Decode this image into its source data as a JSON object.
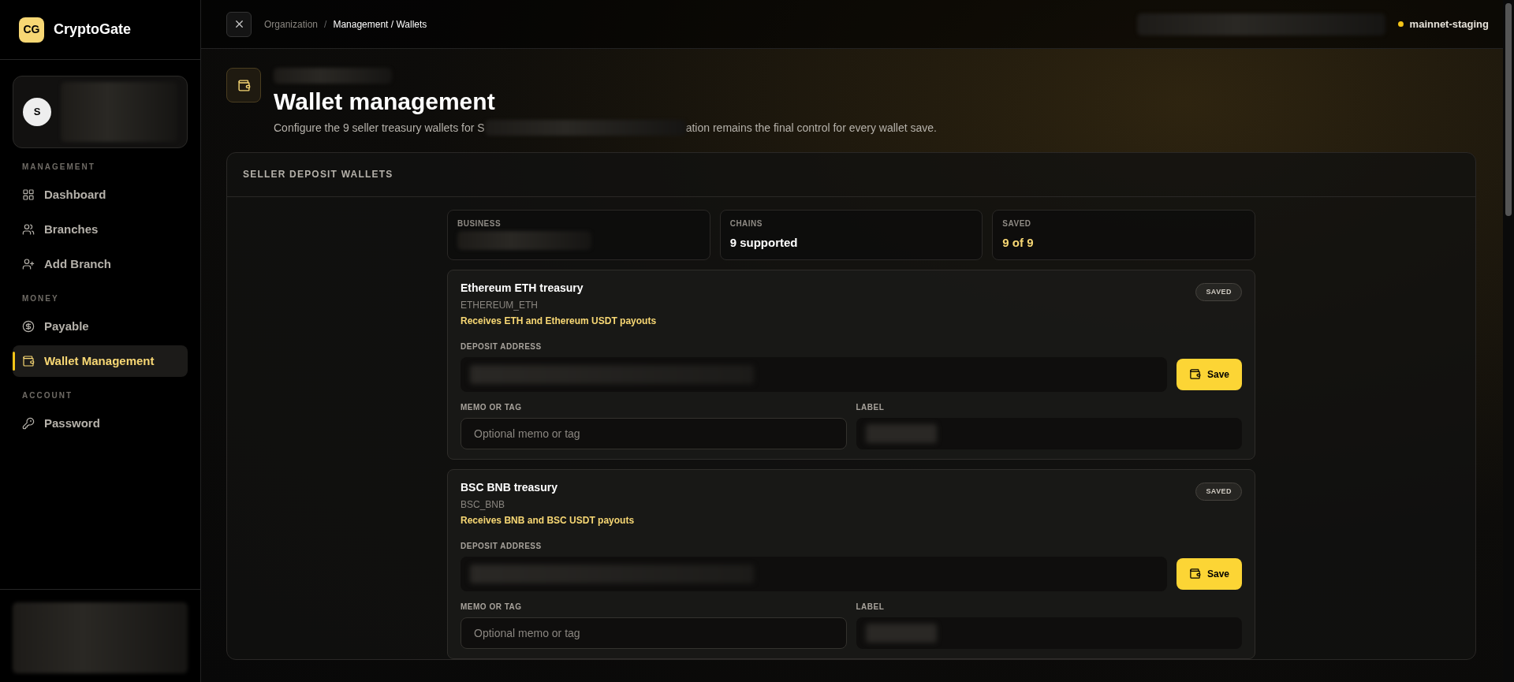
{
  "brand": {
    "logo": "CG",
    "name": "CryptoGate"
  },
  "profile": {
    "initial": "S"
  },
  "sidebar": {
    "sections": [
      {
        "title": "MANAGEMENT",
        "items": [
          {
            "label": "Dashboard",
            "selected": false
          },
          {
            "label": "Branches",
            "selected": false
          },
          {
            "label": "Add Branch",
            "selected": false
          }
        ]
      },
      {
        "title": "MONEY",
        "items": [
          {
            "label": "Payable",
            "selected": false
          },
          {
            "label": "Wallet Management",
            "selected": true
          }
        ]
      },
      {
        "title": "ACCOUNT",
        "items": [
          {
            "label": "Password",
            "selected": false
          }
        ]
      }
    ]
  },
  "topbar": {
    "breadcrumb": [
      "Organization",
      "/",
      "Management / Wallets"
    ],
    "network": "mainnet-staging"
  },
  "page": {
    "title": "Wallet management",
    "description_start": "Configure the 9 seller treasury wallets for S",
    "description_end": "ation remains the final control for every wallet save."
  },
  "panel": {
    "title": "SELLER DEPOSIT WALLETS",
    "stats": [
      {
        "label": "BUSINESS"
      },
      {
        "label": "CHAINS",
        "value": "9 supported",
        "highlight": false
      },
      {
        "label": "SAVED",
        "value": "9 of 9",
        "highlight": true
      }
    ],
    "wallets": [
      {
        "name": "Ethereum ETH treasury",
        "code": "ETHEREUM_ETH",
        "note": "Receives ETH and Ethereum USDT payouts",
        "status": "SAVED",
        "address_label": "DEPOSIT ADDRESS",
        "save": "Save",
        "memo_label": "MEMO OR TAG",
        "memo_placeholder": "Optional memo or tag",
        "label_label": "LABEL"
      },
      {
        "name": "BSC BNB treasury",
        "code": "BSC_BNB",
        "note": "Receives BNB and BSC USDT payouts",
        "status": "SAVED",
        "address_label": "DEPOSIT ADDRESS",
        "save": "Save",
        "memo_label": "MEMO OR TAG",
        "memo_placeholder": "Optional memo or tag",
        "label_label": "LABEL"
      }
    ]
  }
}
